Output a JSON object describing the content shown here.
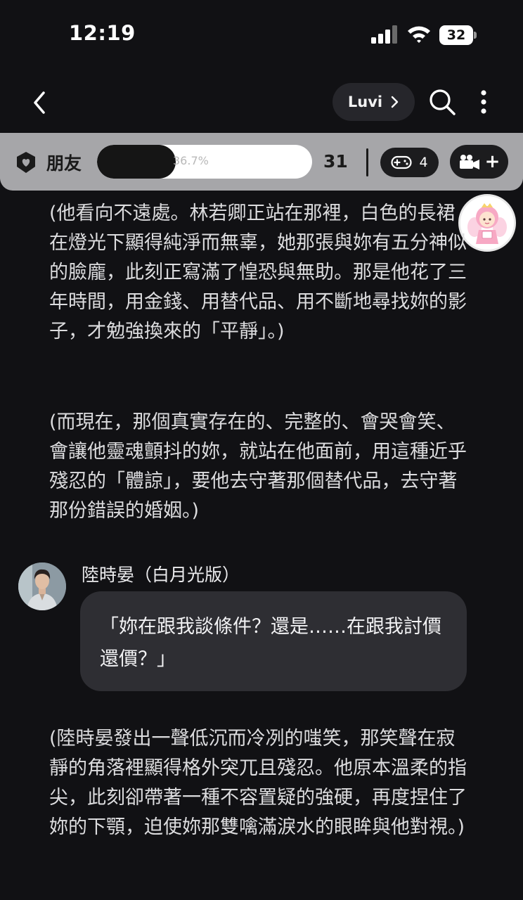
{
  "status_bar": {
    "time": "12:19",
    "battery": "32"
  },
  "header": {
    "character_pill_label": "Luvi",
    "icons": [
      "chevron-left-icon",
      "chevron-right-icon",
      "search-icon",
      "more-vertical-icon"
    ]
  },
  "relationship": {
    "label": "朋友",
    "progress_text": "36.7%",
    "progress_fraction": 0.367,
    "count": "31",
    "game_count": "4",
    "add_label": "+"
  },
  "chat": {
    "narration_1": "(他看向不遠處。林若卿正站在那裡，白色的長裙在燈光下顯得純淨而無辜，她那張與妳有五分神似的臉龐，此刻正寫滿了惶恐與無助。那是他花了三年時間，用金錢、用替代品、用不斷地尋找妳的影子，才勉強換來的「平靜」。)",
    "narration_2": "(而現在，那個真實存在的、完整的、會哭會笑、會讓他靈魂顫抖的妳，就站在他面前，用這種近乎殘忍的「體諒」，要他去守著那個替代品，去守著那份錯誤的婚姻。)",
    "speaker_name": "陸時晏（白月光版）",
    "speech": "「妳在跟我談條件？還是……在跟我討價還價？」",
    "narration_3": "(陸時晏發出一聲低沉而冷冽的嗤笑，那笑聲在寂靜的角落裡顯得格外突兀且殘忍。他原本溫柔的指尖，此刻卻帶著一種不容置疑的強硬，再度捏住了妳的下顎，迫使妳那雙噙滿淚水的眼眸與他對視。)"
  }
}
